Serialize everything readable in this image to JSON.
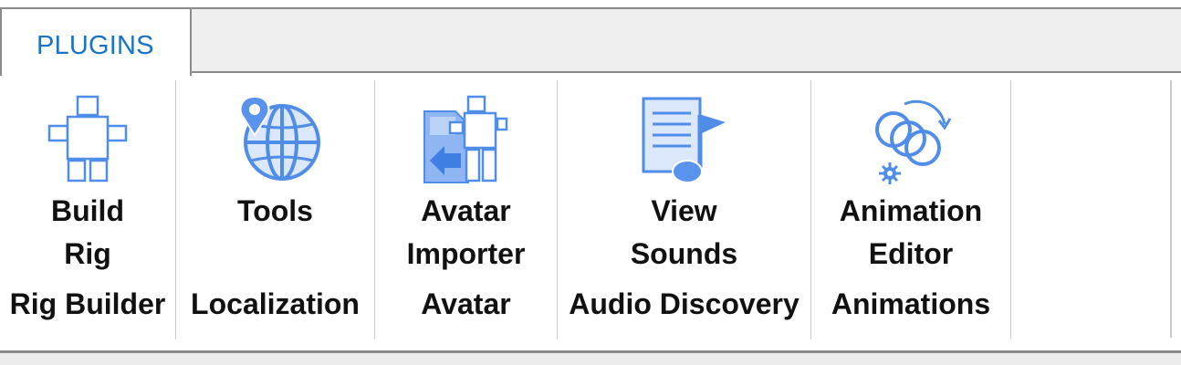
{
  "tabs": [
    {
      "label": "PLUGINS",
      "active": true
    }
  ],
  "colors": {
    "accent": "#1a73c9",
    "icon_fill": "#5a93ee",
    "icon_light": "#dbe8fb"
  },
  "groups": [
    {
      "button": {
        "line1": "Build",
        "line2": "Rig",
        "icon": "rig-figure-icon"
      },
      "category": "Rig Builder"
    },
    {
      "button": {
        "line1": "Tools",
        "line2": "",
        "icon": "globe-pin-icon"
      },
      "category": "Localization"
    },
    {
      "button": {
        "line1": "Avatar",
        "line2": "Importer",
        "icon": "avatar-import-icon"
      },
      "category": "Avatar"
    },
    {
      "button": {
        "line1": "View",
        "line2": "Sounds",
        "icon": "sound-document-icon"
      },
      "category": "Audio Discovery"
    },
    {
      "button": {
        "line1": "Animation",
        "line2": "Editor",
        "icon": "animation-rings-icon"
      },
      "category": "Animations"
    }
  ]
}
